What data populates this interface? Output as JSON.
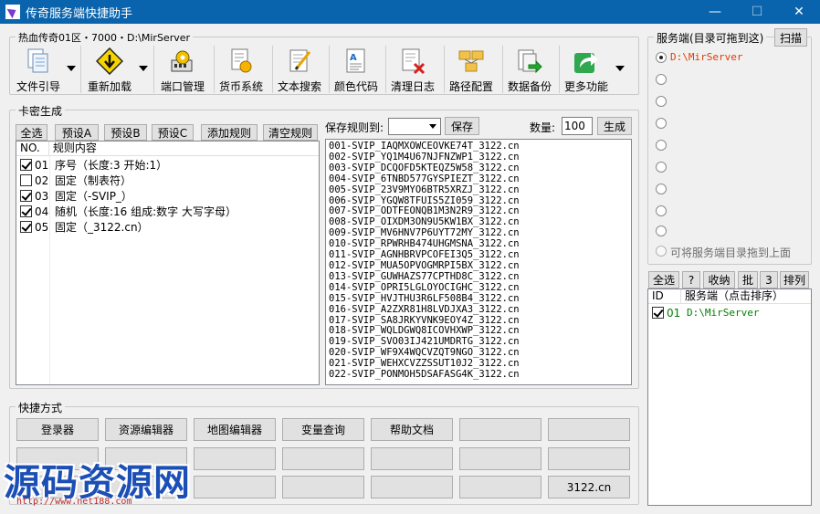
{
  "window": {
    "title": "传奇服务端快捷助手",
    "min": "—",
    "max": "☐",
    "close": "✕"
  },
  "toolbar": {
    "group_label": "热血传奇01区・7000・D:\\MirServer",
    "items": [
      {
        "label": "文件引导",
        "icon": "file-guide-icon"
      },
      {
        "label": "重新加载",
        "icon": "reload-warning-icon"
      },
      {
        "label": "端口管理",
        "icon": "port-gear-icon"
      },
      {
        "label": "货币系统",
        "icon": "currency-coin-icon"
      },
      {
        "label": "文本搜索",
        "icon": "text-search-icon"
      },
      {
        "label": "颜色代码",
        "icon": "color-code-icon"
      },
      {
        "label": "清理日志",
        "icon": "clear-log-icon"
      },
      {
        "label": "路径配置",
        "icon": "path-folder-icon"
      },
      {
        "label": "数据备份",
        "icon": "data-backup-icon"
      },
      {
        "label": "更多功能",
        "icon": "more-share-icon"
      }
    ]
  },
  "card": {
    "group_label": "卡密生成",
    "buttons": [
      "全选",
      "预设A",
      "预设B",
      "预设C",
      "添加规则",
      "清空规则"
    ],
    "columns": [
      "NO.",
      "规则内容"
    ],
    "rules": [
      {
        "checked": true,
        "no": "01",
        "content": "序号（长度:3  开始:1）"
      },
      {
        "checked": false,
        "no": "02",
        "content": "固定（制表符）"
      },
      {
        "checked": true,
        "no": "03",
        "content": "固定（-SVIP_）"
      },
      {
        "checked": true,
        "no": "04",
        "content": "随机（长度:16  组成:数字 大写字母）"
      },
      {
        "checked": true,
        "no": "05",
        "content": "固定（_3122.cn）"
      }
    ],
    "save_rule_label": "保存规则到:",
    "save_button": "保存",
    "count_label": "数量:",
    "count_value": "100",
    "generate_button": "生成",
    "codes": [
      "001-SVIP_IAQMXOWCEOVKE74T_3122.cn",
      "002-SVIP_YQ1M4U67NJFNZWP1_3122.cn",
      "003-SVIP_DCQOFD5KTEQZ5W58_3122.cn",
      "004-SVIP_6TNBD577GYSPIEZT_3122.cn",
      "005-SVIP_23V9MYO6BTR5XRZJ_3122.cn",
      "006-SVIP_YGQW8TFUIS5ZI059_3122.cn",
      "007-SVIP_ODTFEONQB1M3N2R9_3122.cn",
      "008-SVIP_OIXDM3ON9U5KW1BX_3122.cn",
      "009-SVIP_MV6HNV7P6UYT72MY_3122.cn",
      "010-SVIP_RPWRHB474UHGMSNA_3122.cn",
      "011-SVIP_AGNHBRVPCOFEI3Q5_3122.cn",
      "012-SVIP_MUA5OPVOGMRPI5BX_3122.cn",
      "013-SVIP_GUWHAZS77CPTHD8C_3122.cn",
      "014-SVIP_OPRI5LGLOYOCIGHC_3122.cn",
      "015-SVIP_HVJTHU3R6LF508B4_3122.cn",
      "016-SVIP_A2ZXR81H8LVDJXA3_3122.cn",
      "017-SVIP_SA8JRKYVNK9EOY4Z_3122.cn",
      "018-SVIP_WQLDGWQ8ICOVHXWP_3122.cn",
      "019-SVIP_SVO03IJ421UMDRTG_3122.cn",
      "020-SVIP_WF9X4WQCVZQT9NGO_3122.cn",
      "021-SVIP_WEHXCVZZSSUT10J2_3122.cn",
      "022-SVIP_PONMOH5DSAFASG4K_3122.cn"
    ]
  },
  "shortcuts": {
    "group_label": "快捷方式",
    "row1": [
      "登录器",
      "资源编辑器",
      "地图编辑器",
      "变量查询",
      "帮助文档",
      ""
    ],
    "last_button": "3122.cn"
  },
  "server_dir": {
    "group_label": "服务端(目录可拖到这)",
    "scan_button": "扫描",
    "selected": "D:\\MirServer",
    "hint": "可将服务端目录拖到上面"
  },
  "server_list": {
    "buttons": [
      "全选",
      "?",
      "收纳",
      "批",
      "3",
      "排列"
    ],
    "columns": [
      "ID",
      "服务端（点击排序）"
    ],
    "rows": [
      {
        "checked": true,
        "id": "01",
        "path": "D:\\MirServer"
      }
    ]
  },
  "watermark": {
    "text": "源码资源网",
    "url": "http://www.net188.com"
  },
  "colors": {
    "title_bar": "#0a64ad",
    "accent_red": "#e03c00",
    "accent_green": "#008000"
  }
}
